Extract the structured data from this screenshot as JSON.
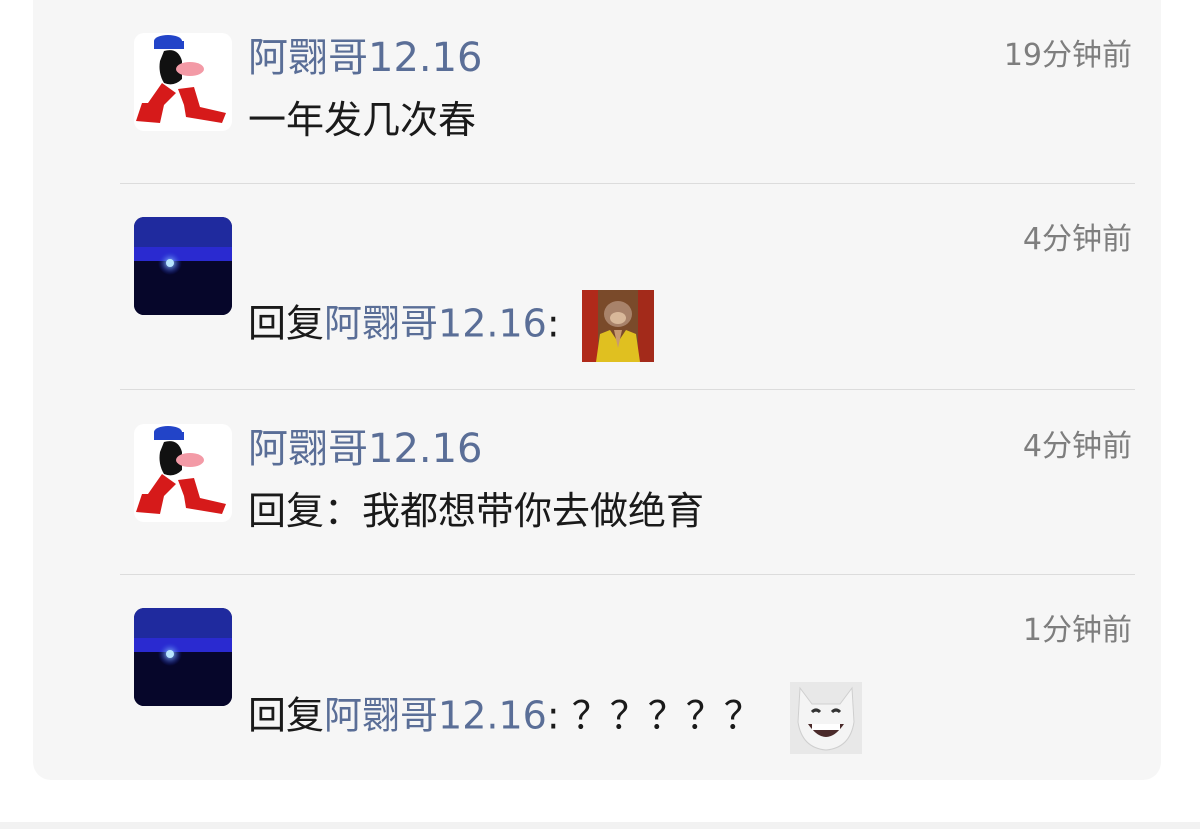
{
  "comments": [
    {
      "author": "阿翾哥12.16",
      "time": "19分钟前",
      "text": "一年发几次春",
      "avatar_icon": "cartoon-legs-avatar"
    },
    {
      "author": "",
      "time": "4分钟前",
      "reply_prefix": "回复",
      "mention": "阿翾哥12.16",
      "reply_suffix": ":",
      "sticker_icon": "monkey-praying-sticker",
      "avatar_icon": "night-blue-avatar"
    },
    {
      "author": "阿翾哥12.16",
      "time": "4分钟前",
      "text": "回复：我都想带你去做绝育",
      "avatar_icon": "cartoon-legs-avatar"
    },
    {
      "author": "",
      "time": "1分钟前",
      "reply_prefix": "回复",
      "mention": "阿翾哥12.16",
      "reply_suffix": ": ？？？？？",
      "sticker_icon": "laughing-cat-sticker",
      "avatar_icon": "night-blue-avatar"
    }
  ],
  "colors": {
    "name_blue": "#5a6e97",
    "card_bg": "#f6f6f6",
    "time_gray": "#7e7e7e"
  }
}
